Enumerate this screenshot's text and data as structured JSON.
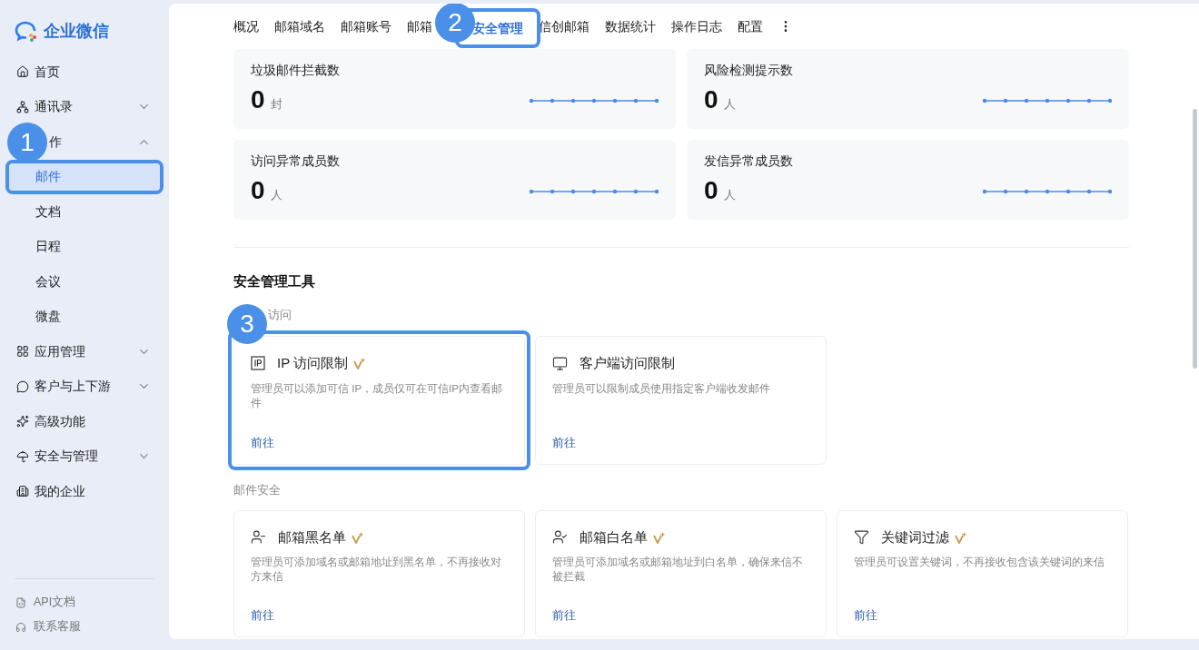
{
  "logo": {
    "text": "企业微信"
  },
  "sidebar": {
    "items": [
      {
        "label": "首页"
      },
      {
        "label": "通讯录",
        "expanded": false
      },
      {
        "label": "作",
        "expanded": true,
        "children": [
          {
            "label": "邮件",
            "selected": true,
            "step": "1"
          },
          {
            "label": "文档",
            "selected": false
          },
          {
            "label": "日程",
            "selected": false
          },
          {
            "label": "会议",
            "selected": false
          },
          {
            "label": "微盘",
            "selected": false
          }
        ]
      },
      {
        "label": "应用管理",
        "expanded": false
      },
      {
        "label": "客户与上下游",
        "expanded": false
      },
      {
        "label": "高级功能"
      },
      {
        "label": "安全与管理",
        "expanded": false
      },
      {
        "label": "我的企业"
      }
    ],
    "footer": [
      {
        "label": "API文档"
      },
      {
        "label": "联系客服"
      }
    ]
  },
  "tabs": [
    {
      "label": "概况",
      "selected": false
    },
    {
      "label": "邮箱域名",
      "selected": false
    },
    {
      "label": "邮箱账号",
      "selected": false
    },
    {
      "label": "邮箱",
      "selected": false
    },
    {
      "label": "安全管理",
      "selected": true,
      "step": "2"
    },
    {
      "label": "信创邮箱",
      "selected": false
    },
    {
      "label": "数据统计",
      "selected": false
    },
    {
      "label": "操作日志",
      "selected": false
    },
    {
      "label": "配置",
      "selected": false
    }
  ],
  "stats": [
    {
      "label": "垃圾邮件拦截数",
      "value": "0",
      "unit": "封"
    },
    {
      "label": "风险检测提示数",
      "value": "0",
      "unit": "人"
    },
    {
      "label": "访问异常成员数",
      "value": "0",
      "unit": "人"
    },
    {
      "label": "发信异常成员数",
      "value": "0",
      "unit": "人"
    }
  ],
  "tools": {
    "title": "安全管理工具",
    "sections": [
      {
        "title": "访问",
        "cards": [
          {
            "title": "IP 访问限制",
            "premium": true,
            "description": "管理员可以添加可信 IP，成员仅可在可信IP内查看邮件",
            "link": "前往",
            "step": "3"
          },
          {
            "title": "客户端访问限制",
            "premium": false,
            "description": "管理员可以限制成员使用指定客户端收发邮件",
            "link": "前往"
          }
        ]
      },
      {
        "title": "邮件安全",
        "cards": [
          {
            "title": "邮箱黑名单",
            "premium": true,
            "description": "管理员可添加域名或邮箱地址到黑名单，不再接收对方来信",
            "link": "前往"
          },
          {
            "title": "邮箱白名单",
            "premium": true,
            "description": "管理员可添加域名或邮箱地址到白名单，确保来信不被拦截",
            "link": "前往"
          },
          {
            "title": "关键词过滤",
            "premium": true,
            "description": "管理员可设置关键词，不再接收包含该关键词的来信",
            "link": "前往"
          }
        ]
      }
    ]
  }
}
